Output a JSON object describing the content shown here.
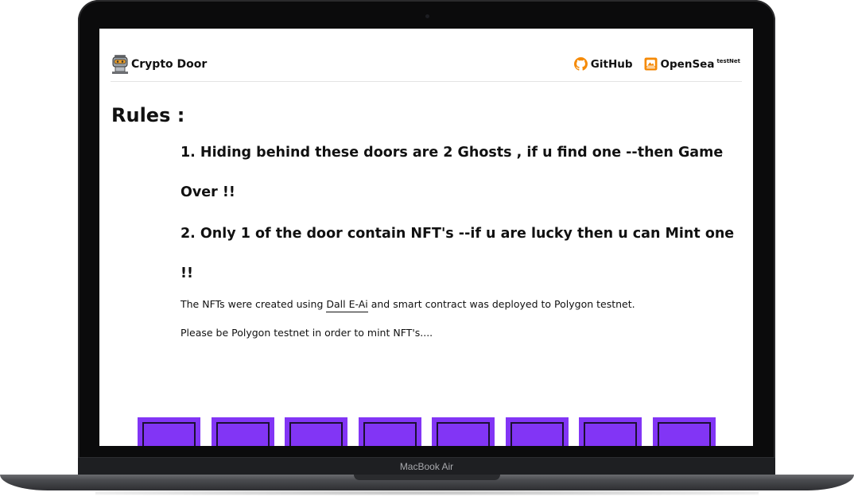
{
  "device": {
    "label": "MacBook Air"
  },
  "navbar": {
    "brand": "Crypto Door",
    "links": [
      {
        "label": "GitHub",
        "icon": "github-icon",
        "color": "#f58a07"
      },
      {
        "label": "OpenSea",
        "badge": "testNet",
        "icon": "opensea-icon",
        "color": "#f58a07"
      }
    ]
  },
  "rules": {
    "title": "Rules :",
    "rule1": "1. Hiding behind these doors are 2 Ghosts , if u find one --then Game Over !!",
    "rule2": "2. Only 1 of the door contain NFT's --if u are lucky then u can Mint one !!",
    "desc1_before": "The NFTs were created using ",
    "desc1_link": "Dall E-Ai",
    "desc1_after": " and smart contract was deployed to Polygon testnet.",
    "desc2": "Please be Polygon testnet in order to mint NFT's...."
  },
  "doors": {
    "count": 8,
    "color": "#8235f5"
  }
}
